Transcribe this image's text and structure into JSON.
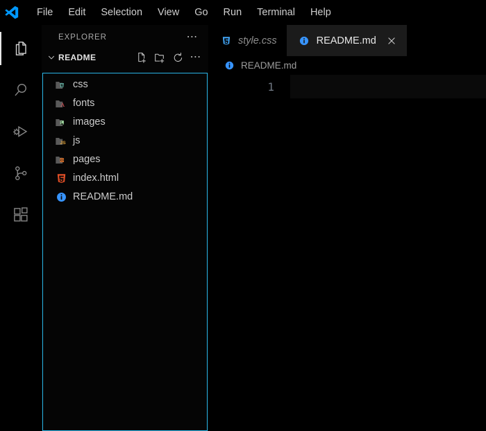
{
  "window": {
    "app_logo_icon": "vscode-logo-icon",
    "background_color": "#000000"
  },
  "menubar": {
    "items": [
      {
        "label": "File"
      },
      {
        "label": "Edit"
      },
      {
        "label": "Selection"
      },
      {
        "label": "View"
      },
      {
        "label": "Go"
      },
      {
        "label": "Run"
      },
      {
        "label": "Terminal"
      },
      {
        "label": "Help"
      }
    ]
  },
  "activitybar": {
    "items": [
      {
        "name": "explorer",
        "icon": "files-icon",
        "active": true
      },
      {
        "name": "search",
        "icon": "search-icon",
        "active": false
      },
      {
        "name": "run-and-debug",
        "icon": "run-debug-icon",
        "active": false
      },
      {
        "name": "source-control",
        "icon": "source-control-icon",
        "active": false
      },
      {
        "name": "extensions",
        "icon": "extensions-icon",
        "active": false
      }
    ]
  },
  "sidebar": {
    "title": "EXPLORER",
    "more_actions_icon": "ellipsis-icon",
    "section": {
      "name": "README",
      "expanded": true,
      "chevron_icon": "chevron-down-icon",
      "actions": [
        {
          "name": "new-file",
          "icon": "new-file-icon"
        },
        {
          "name": "new-folder",
          "icon": "new-folder-icon"
        },
        {
          "name": "refresh",
          "icon": "refresh-icon"
        },
        {
          "name": "more-actions",
          "icon": "ellipsis-icon"
        }
      ]
    },
    "focus_border_color": "#29b6e8",
    "tree": [
      {
        "label": "css",
        "icon": "folder-css-icon",
        "type": "folder"
      },
      {
        "label": "fonts",
        "icon": "folder-fonts-icon",
        "type": "folder"
      },
      {
        "label": "images",
        "icon": "folder-images-icon",
        "type": "folder"
      },
      {
        "label": "js",
        "icon": "folder-js-icon",
        "type": "folder"
      },
      {
        "label": "pages",
        "icon": "folder-pages-icon",
        "type": "folder"
      },
      {
        "label": "index.html",
        "icon": "html5-icon",
        "type": "file"
      },
      {
        "label": "README.md",
        "icon": "info-icon",
        "type": "file"
      }
    ]
  },
  "editor": {
    "tabs": [
      {
        "label": "style.css",
        "icon": "css3-icon",
        "active": false,
        "preview": true,
        "closable": false
      },
      {
        "label": "README.md",
        "icon": "info-icon",
        "active": true,
        "preview": false,
        "closable": true,
        "close_icon": "close-icon"
      }
    ],
    "breadcrumb": {
      "label": "README.md",
      "icon": "info-icon"
    },
    "lines": [
      {
        "number": "1",
        "text": ""
      }
    ],
    "current_line": "1"
  }
}
